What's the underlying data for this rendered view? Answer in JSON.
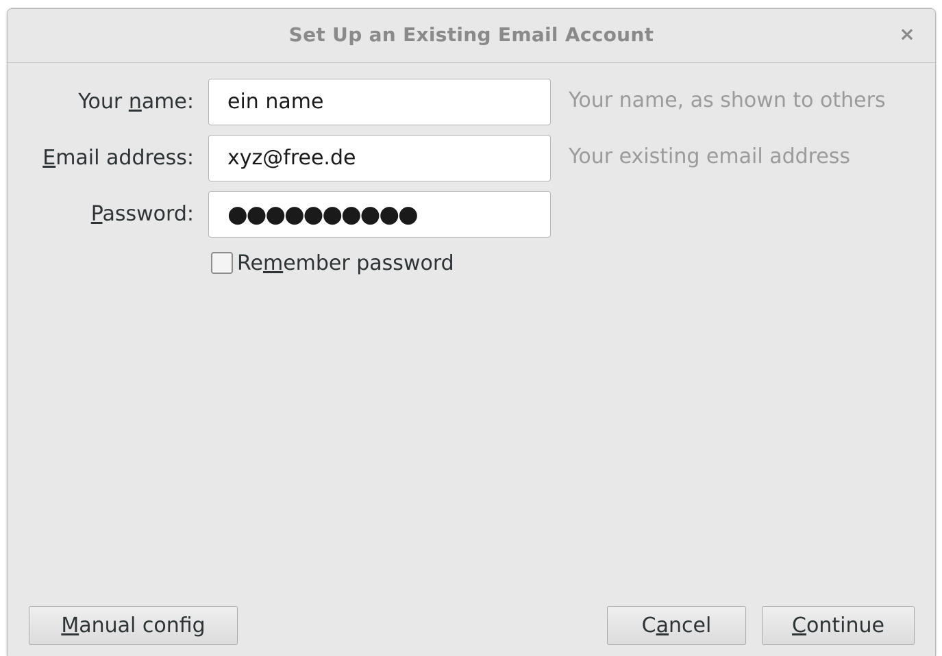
{
  "dialog": {
    "title": "Set Up an Existing Email Account",
    "close_label": "×"
  },
  "form": {
    "name": {
      "label_pre": "Your ",
      "label_mnemonic": "n",
      "label_post": "ame:",
      "value": "ein name",
      "hint": "Your name, as shown to others"
    },
    "email": {
      "label_pre": "",
      "label_mnemonic": "E",
      "label_post": "mail address:",
      "value": "xyz@free.de",
      "hint": "Your existing email address"
    },
    "password": {
      "label_pre": "",
      "label_mnemonic": "P",
      "label_post": "assword:",
      "masked_value": "●●●●●●●●●●"
    },
    "remember": {
      "label_pre": "Re",
      "label_mnemonic": "m",
      "label_post": "ember password",
      "checked": false
    }
  },
  "buttons": {
    "manual_pre": "",
    "manual_mnemonic": "M",
    "manual_post": "anual config",
    "cancel_pre": "C",
    "cancel_mnemonic": "a",
    "cancel_post": "ncel",
    "continue_pre": "",
    "continue_mnemonic": "C",
    "continue_post": "ontinue"
  }
}
